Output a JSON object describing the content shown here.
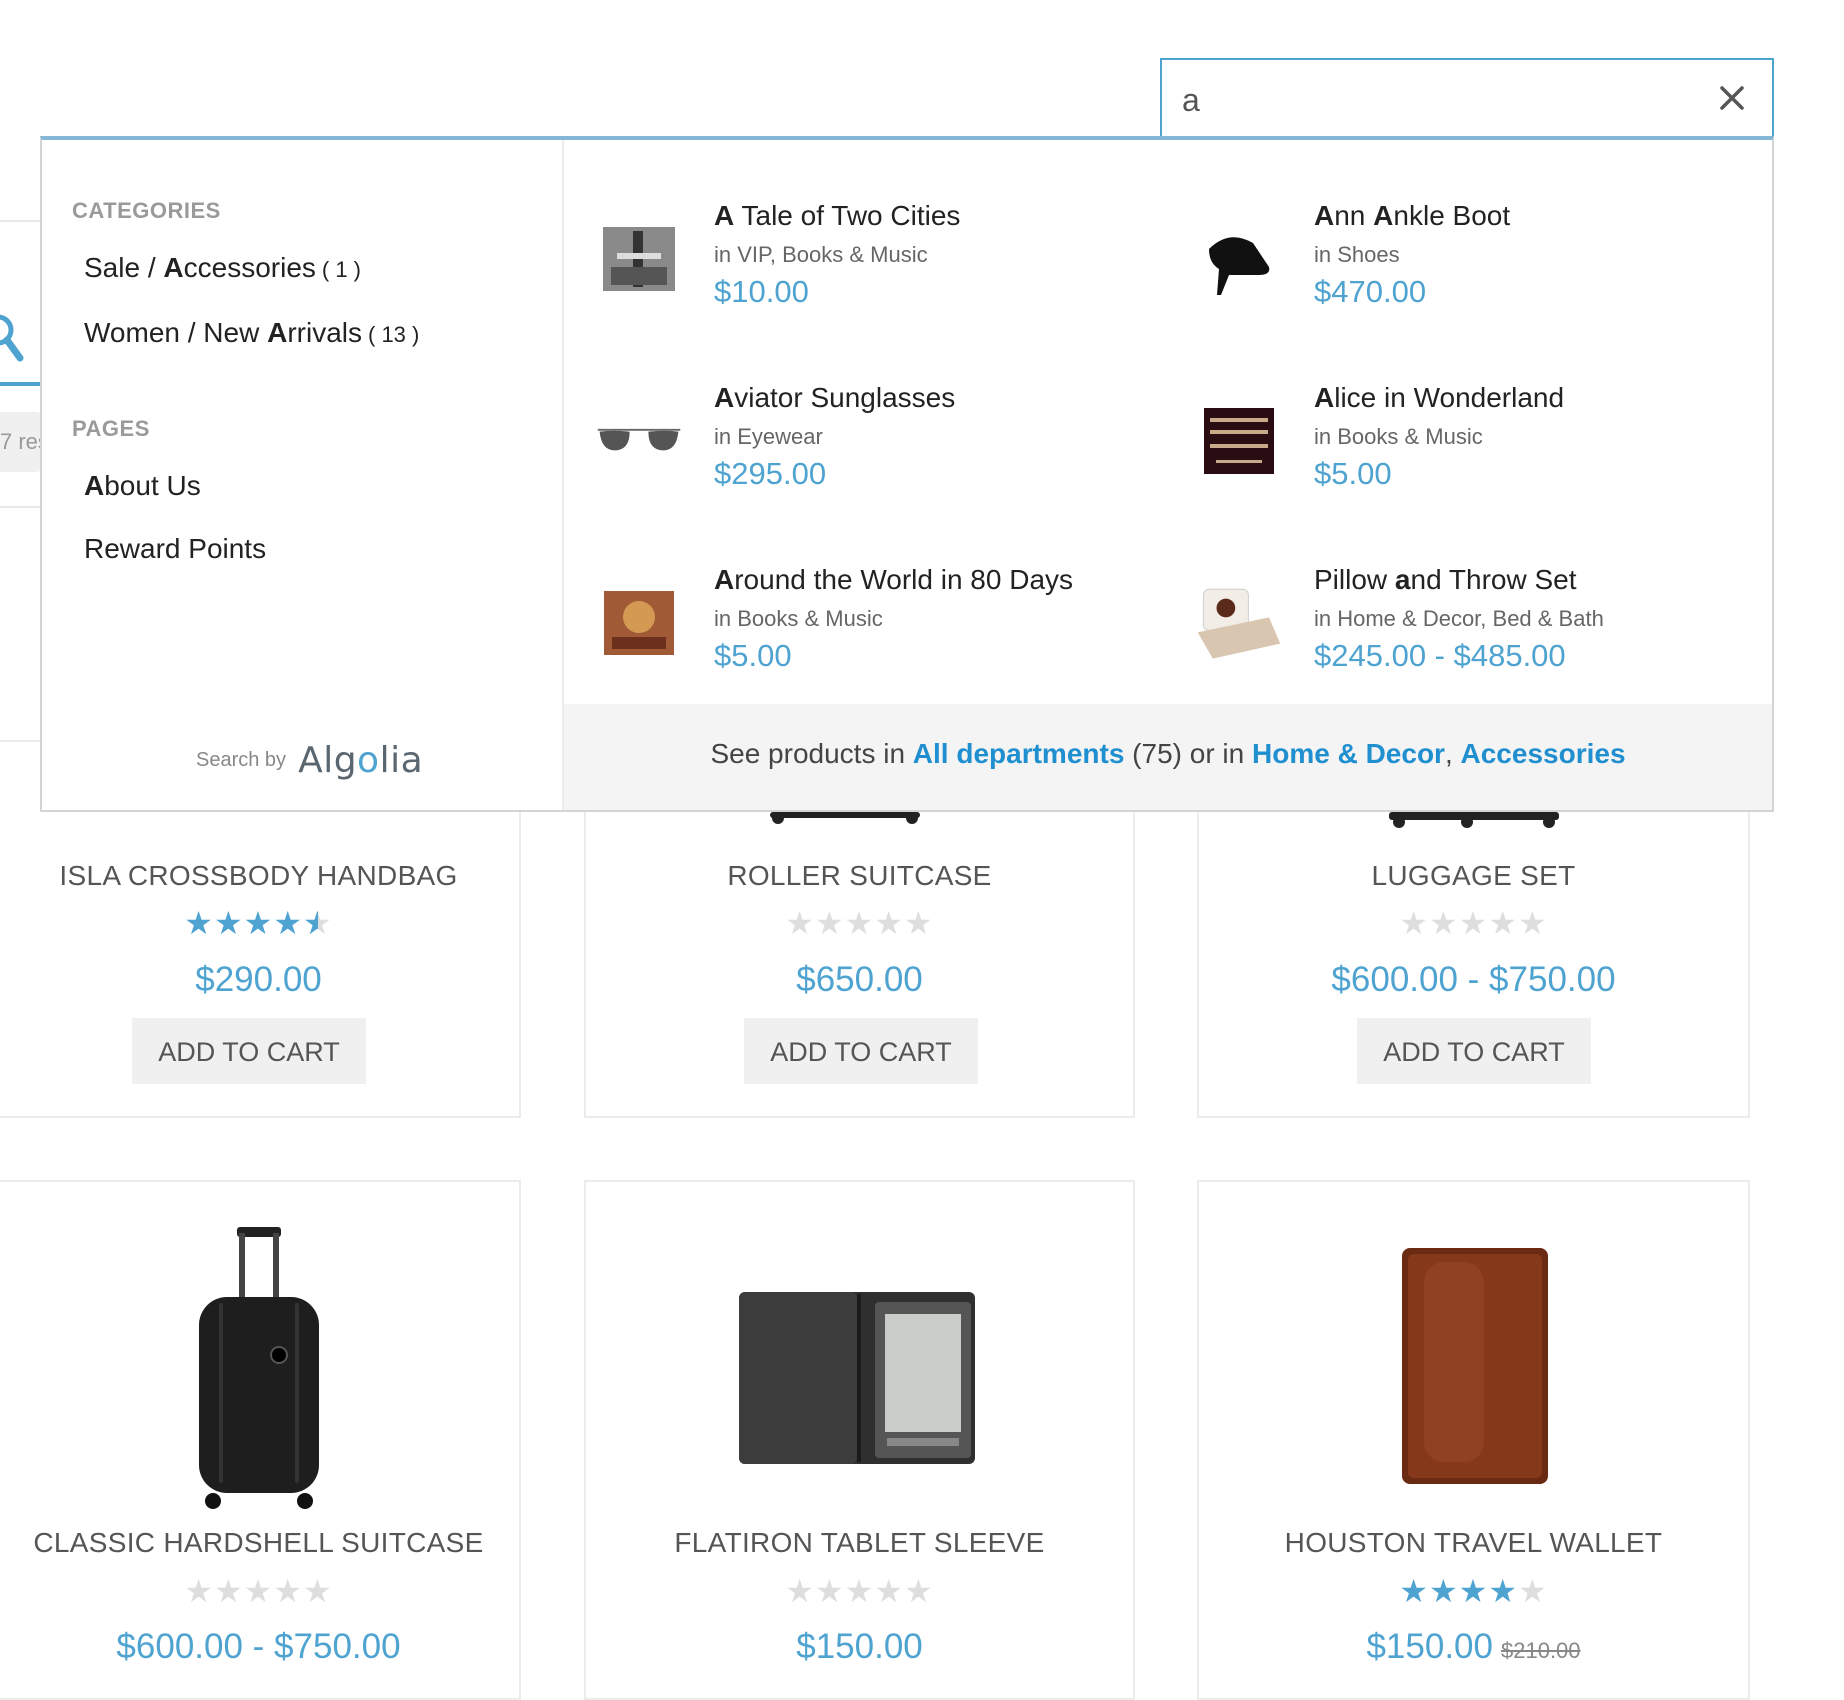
{
  "search": {
    "value": "a",
    "clear_label": "×"
  },
  "background": {
    "results_fragment": "7 res"
  },
  "dropdown": {
    "categories_heading": "CATEGORIES",
    "categories": [
      {
        "path_pre": "Sale / ",
        "path_bold": "A",
        "path_post": "ccessories",
        "count": "( 1 )"
      },
      {
        "path_pre": "Women / New ",
        "path_bold": "A",
        "path_post": "rrivals",
        "count": "( 13 )"
      }
    ],
    "pages_heading": "PAGES",
    "pages": [
      {
        "bold": "A",
        "rest": "bout Us"
      },
      {
        "bold": "",
        "rest": "Reward Points"
      }
    ],
    "powered_label": "Search by",
    "powered_logo_pre": "Alg",
    "powered_logo_o": "o",
    "powered_logo_post": "lia",
    "products": [
      {
        "bold": "A",
        "rest": " Tale of Two Cities",
        "category": "in VIP, Books & Music",
        "price": "$10.00",
        "thumb": "book-cover-icon"
      },
      {
        "bold": "A",
        "rest": "nn ",
        "bold2": "A",
        "rest2": "nkle Boot",
        "category": "in Shoes",
        "price": "$470.00",
        "thumb": "boot-icon"
      },
      {
        "bold": "A",
        "rest": "viator Sunglasses",
        "category": "in Eyewear",
        "price": "$295.00",
        "thumb": "sunglasses-icon"
      },
      {
        "bold": "A",
        "rest": "lice in Wonderland",
        "category": "in Books & Music",
        "price": "$5.00",
        "thumb": "book-cover-icon"
      },
      {
        "bold": "A",
        "rest": "round the World in 80 Days",
        "category": "in Books & Music",
        "price": "$5.00",
        "thumb": "book-cover-icon"
      },
      {
        "bold": "",
        "rest": "Pillow ",
        "bold2": "a",
        "rest2": "nd Throw Set",
        "category": "in Home & Decor, Bed & Bath",
        "price": "$245.00 - $485.00",
        "thumb": "pillow-icon"
      }
    ],
    "footer": {
      "text1": "See products in ",
      "link1": "All departments",
      "text2": " (75) or in ",
      "link2": "Home & Decor",
      "text3": ", ",
      "link3": "Accessories"
    }
  },
  "product_cards": [
    {
      "name": "ISLA CROSSBODY HANDBAG",
      "rating": 4.5,
      "price": "$290.00",
      "old_price": "",
      "button": "ADD TO CART"
    },
    {
      "name": "ROLLER SUITCASE",
      "rating": 0,
      "price": "$650.00",
      "old_price": "",
      "button": "ADD TO CART"
    },
    {
      "name": "LUGGAGE SET",
      "rating": 0,
      "price": "$600.00 - $750.00",
      "old_price": "",
      "button": "ADD TO CART"
    },
    {
      "name": "CLASSIC HARDSHELL SUITCASE",
      "rating": 0,
      "price": "$600.00 - $750.00",
      "old_price": ""
    },
    {
      "name": "FLATIRON TABLET SLEEVE",
      "rating": 0,
      "price": "$150.00",
      "old_price": ""
    },
    {
      "name": "HOUSTON TRAVEL WALLET",
      "rating": 4,
      "price": "$150.00",
      "old_price": "$210.00"
    }
  ],
  "colors": {
    "accent": "#4fa3d1",
    "link": "#1f8fd0",
    "border": "#d4d4d4"
  }
}
